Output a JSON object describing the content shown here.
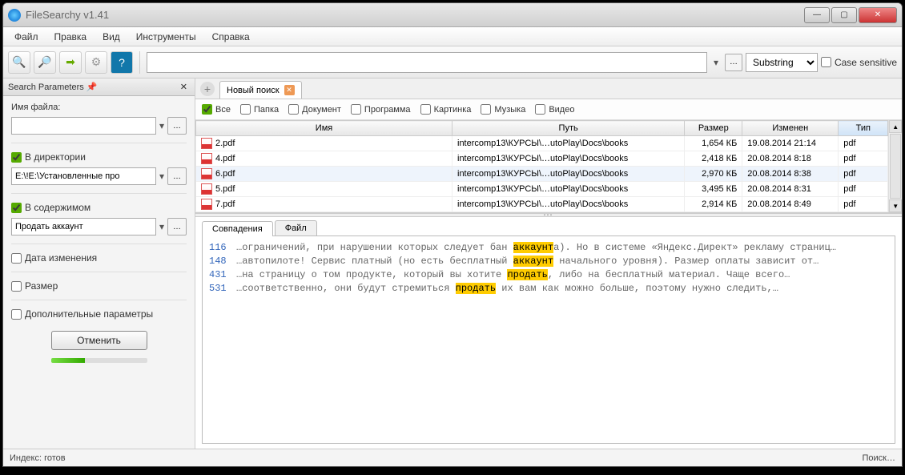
{
  "window": {
    "title": "FileSearchy v1.41"
  },
  "menu": {
    "file": "Файл",
    "edit": "Правка",
    "view": "Вид",
    "tools": "Инструменты",
    "help": "Справка"
  },
  "toolbar": {
    "search_value": "",
    "mode": "Substring",
    "case_sensitive": "Case sensitive"
  },
  "sidebar": {
    "title": "Search Parameters",
    "filename_label": "Имя файла:",
    "filename_value": "",
    "in_dir_label": "В директории",
    "dir_value": "E:\\!E:\\Установленные про",
    "in_content_label": "В содержимом",
    "content_value": "Продать аккаунт",
    "date_label": "Дата изменения",
    "size_label": "Размер",
    "extra_label": "Дополнительные параметры",
    "cancel": "Отменить"
  },
  "tabs": {
    "new_search": "Новый поиск"
  },
  "filters": {
    "all": "Все",
    "folder": "Папка",
    "document": "Документ",
    "program": "Программа",
    "image": "Картинка",
    "music": "Музыка",
    "video": "Видео"
  },
  "columns": {
    "name": "Имя",
    "path": "Путь",
    "size": "Размер",
    "modified": "Изменен",
    "type": "Тип"
  },
  "rows": [
    {
      "name": "2.pdf",
      "path": "intercomp13\\КУРСЫ\\…utoPlay\\Docs\\books",
      "size": "1,654 КБ",
      "modified": "19.08.2014 21:14",
      "type": "pdf"
    },
    {
      "name": "4.pdf",
      "path": "intercomp13\\КУРСЫ\\…utoPlay\\Docs\\books",
      "size": "2,418 КБ",
      "modified": "20.08.2014 8:18",
      "type": "pdf"
    },
    {
      "name": "6.pdf",
      "path": "intercomp13\\КУРСЫ\\…utoPlay\\Docs\\books",
      "size": "2,970 КБ",
      "modified": "20.08.2014 8:38",
      "type": "pdf",
      "selected": true
    },
    {
      "name": "5.pdf",
      "path": "intercomp13\\КУРСЫ\\…utoPlay\\Docs\\books",
      "size": "3,495 КБ",
      "modified": "20.08.2014 8:31",
      "type": "pdf"
    },
    {
      "name": "7.pdf",
      "path": "intercomp13\\КУРСЫ\\…utoPlay\\Docs\\books",
      "size": "2,914 КБ",
      "modified": "20.08.2014 8:49",
      "type": "pdf"
    }
  ],
  "preview": {
    "matches_tab": "Совпадения",
    "file_tab": "Файл",
    "lines": [
      {
        "num": "116",
        "pre": "…ограничений, при нарушении которых следует бан ",
        "hl": "аккаунт",
        "post": "а). Но в системе «Яндекс.Директ» рекламу страниц…"
      },
      {
        "num": "148",
        "pre": "…автопилоте! Сервис платный (но есть бесплатный ",
        "hl": "аккаунт",
        "post": " начального уровня). Размер оплаты зависит от…"
      },
      {
        "num": "431",
        "pre": "…на страницу о том продукте, который вы хотите ",
        "hl": "продать",
        "post": ", либо на бесплатный материал. Чаще всего…"
      },
      {
        "num": "531",
        "pre": "…соответственно, они будут стремиться ",
        "hl": "продать",
        "post": " их вам как можно больше, поэтому нужно следить,…"
      }
    ]
  },
  "status": {
    "left": "Индекс: готов",
    "right": "Поиск…"
  }
}
